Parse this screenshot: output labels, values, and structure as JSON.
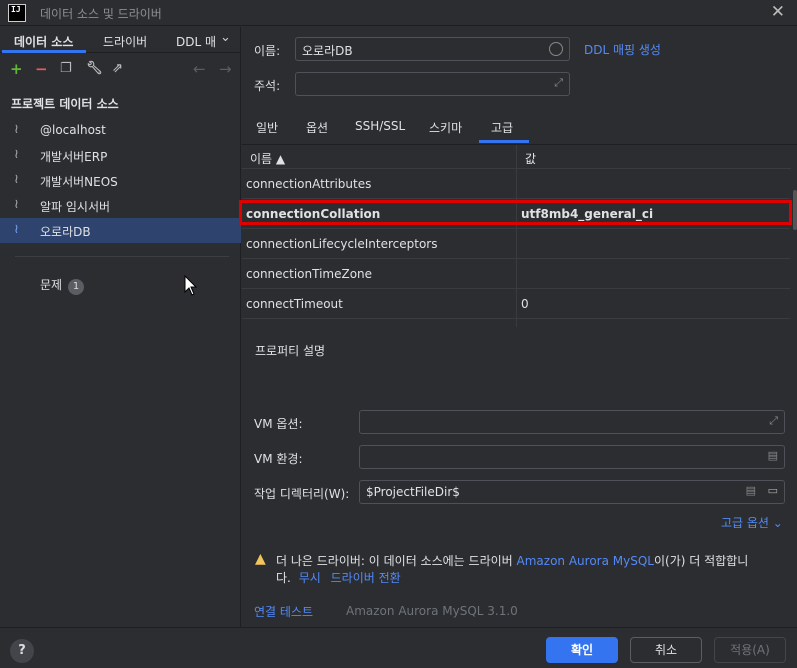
{
  "window": {
    "title": "데이터 소스 및 드라이버",
    "icon_text": "IJ"
  },
  "left_tabs": [
    {
      "label": "데이터 소스"
    },
    {
      "label": "드라이버"
    },
    {
      "label": "DDL 매"
    }
  ],
  "left_section": "프로젝트 데이터 소스",
  "data_sources": [
    {
      "label": "@localhost"
    },
    {
      "label": "개발서버ERP"
    },
    {
      "label": "개발서버NEOS"
    },
    {
      "label": "알파 임시서버"
    },
    {
      "label": "오로라DB"
    }
  ],
  "problems": {
    "label": "문제",
    "count": "1"
  },
  "form": {
    "name_label": "이름:",
    "name_value": "오로라DB",
    "ddl_link": "DDL 매핑 생성",
    "comment_label": "주석:"
  },
  "sub_tabs": [
    "일반",
    "옵션",
    "SSH/SSL",
    "스키마",
    "고급"
  ],
  "table": {
    "col_name": "이름 ▲",
    "col_value": "값",
    "rows": [
      {
        "name": "connectionAttributes",
        "value": ""
      },
      {
        "name": "connectionCollation",
        "value": "utf8mb4_general_ci"
      },
      {
        "name": "connectionLifecycleInterceptors",
        "value": ""
      },
      {
        "name": "connectionTimeZone",
        "value": ""
      },
      {
        "name": "connectTimeout",
        "value": "0"
      }
    ]
  },
  "property_desc": "프로퍼티 설명",
  "vm_options_label": "VM 옵션:",
  "vm_env_label": "VM 환경:",
  "workdir_label": "작업 디렉터리(W):",
  "workdir_value": "$ProjectFileDir$",
  "advanced_options": "고급 옵션",
  "warning": {
    "text": "더 나은 드라이버: 이 데이터 소스에는 드라이버",
    "driver_link": "Amazon Aurora MySQL",
    "text2": "이(가) 더 적합합니",
    "text3": "다.",
    "ignore_link": "무시",
    "switch_link": "드라이버 전환"
  },
  "test_connection": "연결 테스트",
  "driver_version": "Amazon Aurora MySQL 3.1.0",
  "buttons": {
    "ok": "확인",
    "cancel": "취소",
    "apply": "적용(A)",
    "help": "?"
  },
  "colors": {
    "accent": "#3574f0",
    "link": "#548af7",
    "highlight_border": "#e00000"
  }
}
